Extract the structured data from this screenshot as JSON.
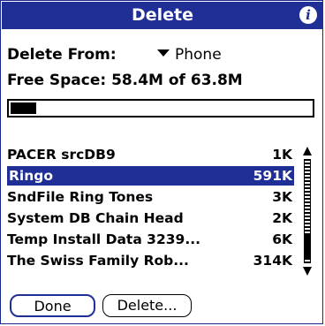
{
  "header": {
    "title": "Delete",
    "info_icon": "info-icon"
  },
  "delete_from": {
    "label": "Delete From:",
    "value": "Phone"
  },
  "free_space": {
    "text": "Free Space: 58.4M of 63.8M",
    "used_fraction": 0.085
  },
  "items": [
    {
      "name": "PACER srcDB9",
      "size": "1K",
      "selected": false
    },
    {
      "name": "Ringo",
      "size": "591K",
      "selected": true
    },
    {
      "name": "SndFile Ring Tones",
      "size": "3K",
      "selected": false
    },
    {
      "name": "System DB Chain Head",
      "size": "2K",
      "selected": false
    },
    {
      "name": "Temp Install Data 3239...",
      "size": "6K",
      "selected": false
    },
    {
      "name": "The Swiss Family Rob...",
      "size": "314K",
      "selected": false
    }
  ],
  "buttons": {
    "done": "Done",
    "delete": "Delete..."
  },
  "colors": {
    "accent": "#1f2f95"
  }
}
